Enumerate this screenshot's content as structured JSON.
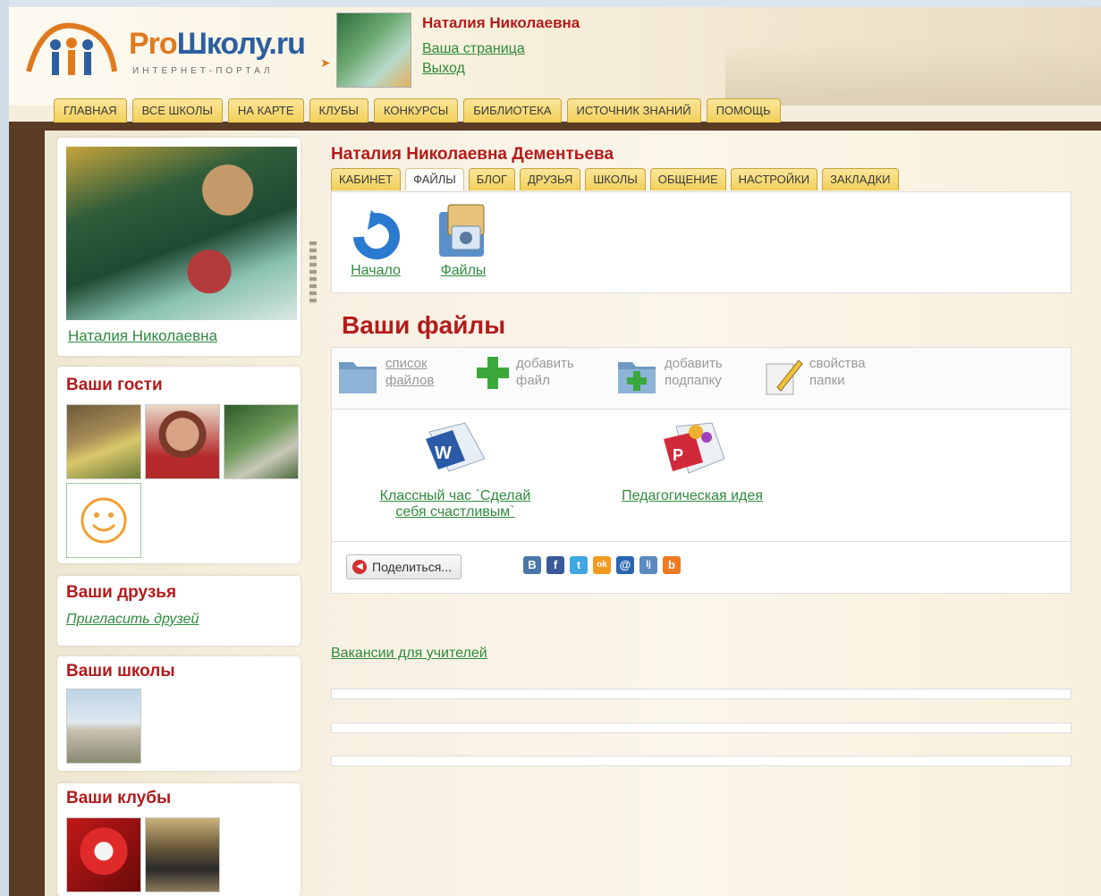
{
  "header": {
    "logo": {
      "pro": "Pro",
      "shkolu": "Школу.ru",
      "subtitle": "ИНТЕРНЕТ-ПОРТАЛ"
    },
    "user": {
      "name": "Наталия Николаевна",
      "page_link": "Ваша страница",
      "logout_link": "Выход"
    }
  },
  "top_nav": {
    "items": [
      "ГЛАВНАЯ",
      "ВСЕ ШКОЛЫ",
      "НА КАРТЕ",
      "КЛУБЫ",
      "КОНКУРСЫ",
      "БИБЛИОТЕКА",
      "ИСТОЧНИК ЗНАНИЙ",
      "ПОМОЩЬ"
    ]
  },
  "sidebar": {
    "profile_name": "Наталия Николаевна",
    "guests_title": "Ваши гости",
    "friends_title": "Ваши друзья",
    "invite_friends": "Пригласить друзей",
    "schools_title": "Ваши школы",
    "clubs_title": "Ваши клубы"
  },
  "main": {
    "full_name": "Наталия Николаевна Дементьева",
    "tabs": [
      "КАБИНЕТ",
      "ФАЙЛЫ",
      "БЛОГ",
      "ДРУЗЬЯ",
      "ШКОЛЫ",
      "ОБЩЕНИЕ",
      "НАСТРОЙКИ",
      "ЗАКЛАДКИ"
    ],
    "active_tab": "ФАЙЛЫ",
    "nav_icons": [
      {
        "label": "Начало",
        "icon": "refresh-arrow-icon"
      },
      {
        "label": "Файлы",
        "icon": "photo-folder-icon"
      }
    ],
    "files_heading": "Ваши файлы",
    "toolbar": {
      "list_files": [
        "список",
        "файлов"
      ],
      "add_file": [
        "добавить",
        "файл"
      ],
      "add_subfolder": [
        "добавить",
        "подпапку"
      ],
      "folder_props": [
        "свойства",
        "папки"
      ]
    },
    "files": [
      {
        "name_line1": "Классный час `Сделай",
        "name_line2": "себя счастливым`",
        "icon": "word-document-icon"
      },
      {
        "name_line1": "Педагогическая идея",
        "name_line2": "",
        "icon": "presentation-icon"
      }
    ],
    "share": {
      "label": "Поделиться...",
      "networks": [
        "В",
        "f",
        "t",
        "ok",
        "@",
        "lj",
        "b"
      ]
    },
    "vacancies_link": "Вакансии для учителей"
  },
  "colors": {
    "accent_red": "#b31b1b",
    "link_green": "#2e8b3c",
    "tab_yellow": "#f2cf59"
  }
}
